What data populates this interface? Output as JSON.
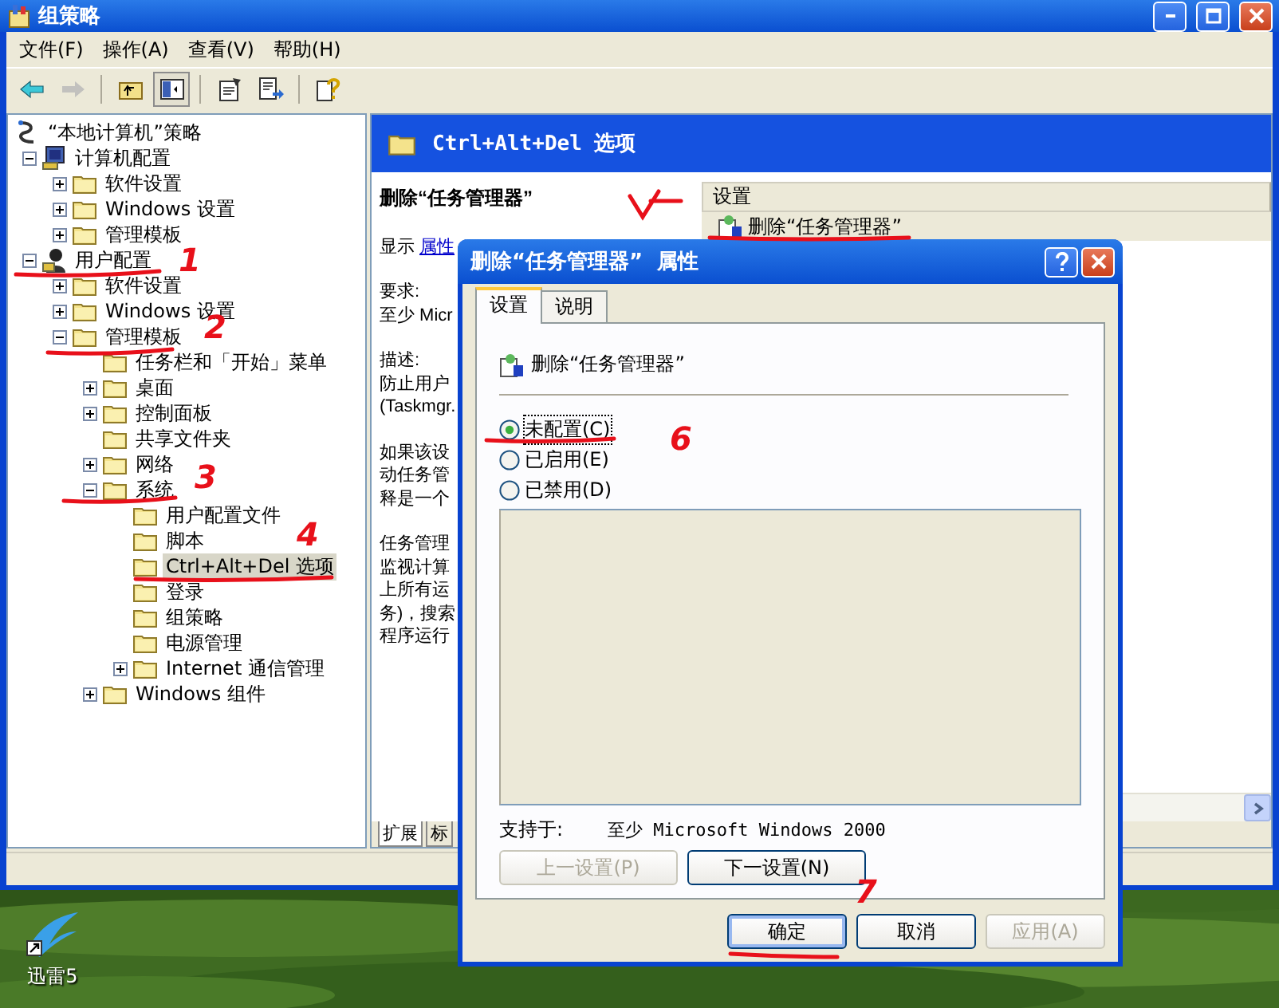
{
  "window": {
    "title": "组策略"
  },
  "menu": [
    "文件(F)",
    "操作(A)",
    "查看(V)",
    "帮助(H)"
  ],
  "toolbar": [
    {
      "kind": "back",
      "disabled": false
    },
    {
      "kind": "forward",
      "disabled": true
    },
    {
      "kind": "separator"
    },
    {
      "kind": "up",
      "disabled": false
    },
    {
      "kind": "tree",
      "disabled": false
    },
    {
      "kind": "separator"
    },
    {
      "kind": "properties",
      "disabled": false
    },
    {
      "kind": "export",
      "disabled": false
    },
    {
      "kind": "separator"
    },
    {
      "kind": "help",
      "disabled": false
    }
  ],
  "tree": [
    {
      "label": "“本地计算机”策略",
      "kind": "policy",
      "selected": false,
      "children": [
        {
          "label": "计算机配置",
          "kind": "computer",
          "selected": false,
          "expanded": true,
          "children": [
            {
              "label": "软件设置",
              "kind": "folder",
              "selected": false,
              "expanded": false
            },
            {
              "label": "Windows 设置",
              "kind": "folder",
              "selected": false,
              "expanded": false
            },
            {
              "label": "管理模板",
              "kind": "folder",
              "selected": false,
              "expanded": false
            }
          ]
        },
        {
          "label": "用户配置",
          "kind": "user",
          "selected": false,
          "expanded": true,
          "children": [
            {
              "label": "软件设置",
              "kind": "folder",
              "selected": false,
              "expanded": false
            },
            {
              "label": "Windows 设置",
              "kind": "folder",
              "selected": false,
              "expanded": false
            },
            {
              "label": "管理模板",
              "kind": "folder",
              "selected": false,
              "expanded": true,
              "children": [
                {
                  "label": "任务栏和「开始」菜单",
                  "kind": "folder",
                  "selected": false
                },
                {
                  "label": "桌面",
                  "kind": "folder",
                  "selected": false,
                  "expanded": false
                },
                {
                  "label": "控制面板",
                  "kind": "folder",
                  "selected": false,
                  "expanded": false
                },
                {
                  "label": "共享文件夹",
                  "kind": "folder",
                  "selected": false
                },
                {
                  "label": "网络",
                  "kind": "folder",
                  "selected": false,
                  "expanded": false
                },
                {
                  "label": "系统",
                  "kind": "folder",
                  "selected": false,
                  "expanded": true,
                  "children": [
                    {
                      "label": "用户配置文件",
                      "kind": "folder",
                      "selected": false
                    },
                    {
                      "label": "脚本",
                      "kind": "folder",
                      "selected": false
                    },
                    {
                      "label": "Ctrl+Alt+Del 选项",
                      "kind": "folder",
                      "selected": true
                    },
                    {
                      "label": "登录",
                      "kind": "folder",
                      "selected": false
                    },
                    {
                      "label": "组策略",
                      "kind": "folder",
                      "selected": false
                    },
                    {
                      "label": "电源管理",
                      "kind": "folder",
                      "selected": false
                    },
                    {
                      "label": "Internet 通信管理",
                      "kind": "folder",
                      "selected": false,
                      "expanded": false
                    }
                  ]
                },
                {
                  "label": "Windows 组件",
                  "kind": "folder",
                  "selected": false,
                  "expanded": false
                }
              ]
            }
          ]
        }
      ]
    }
  ],
  "detail": {
    "header": "Ctrl+Alt+Del 选项",
    "title": "删除“任务管理器”",
    "show_label": "显示",
    "show_link": "属性",
    "blocks": [
      {
        "lines": [
          "要求:",
          "至少 Micr"
        ]
      },
      {
        "lines": [
          "描述:",
          "防止用户",
          "(Taskmgr."
        ]
      },
      {
        "lines": [
          "如果该设",
          "动任务管",
          "释是一个"
        ]
      },
      {
        "lines": [
          "任务管理",
          "监视计算",
          "上所有运",
          "务)，搜索",
          "程序运行"
        ]
      }
    ]
  },
  "list": {
    "column": "设置",
    "rows": [
      {
        "label": "删除“任务管理器”",
        "selected": true
      }
    ]
  },
  "view_tabs": [
    {
      "label": "扩展",
      "selected": true
    },
    {
      "label": "标",
      "selected": false
    }
  ],
  "dialog": {
    "title": "删除“任务管理器”  属性",
    "tabs": [
      {
        "label": "设置",
        "selected": true
      },
      {
        "label": "说明",
        "selected": false
      }
    ],
    "setting": "删除“任务管理器”",
    "options": [
      {
        "label": "未配置(C)",
        "selected": true
      },
      {
        "label": "已启用(E)",
        "selected": false
      },
      {
        "label": "已禁用(D)",
        "selected": false
      }
    ],
    "supported_label": "支持于:",
    "supported_value": "至少 Microsoft Windows 2000",
    "nav_buttons": [
      {
        "label": "上一设置(P)",
        "disabled": true
      },
      {
        "label": "下一设置(N)",
        "disabled": false
      }
    ],
    "buttons": [
      {
        "label": "确定",
        "disabled": false
      },
      {
        "label": "取消",
        "disabled": false
      },
      {
        "label": "应用(A)",
        "disabled": true
      }
    ]
  },
  "desktop_icons": [
    {
      "label": "迅雷5"
    }
  ],
  "annotations": [
    {
      "kind": "underline"
    },
    {
      "kind": "number",
      "label": "1"
    },
    {
      "kind": "underline"
    },
    {
      "kind": "number",
      "label": "2"
    },
    {
      "kind": "underline"
    },
    {
      "kind": "number",
      "label": "3"
    },
    {
      "kind": "underline"
    },
    {
      "kind": "number",
      "label": "4"
    },
    {
      "kind": "check"
    },
    {
      "kind": "underline"
    },
    {
      "kind": "underline"
    },
    {
      "kind": "number",
      "label": "6"
    },
    {
      "kind": "underline"
    },
    {
      "kind": "number",
      "label": "7"
    }
  ]
}
